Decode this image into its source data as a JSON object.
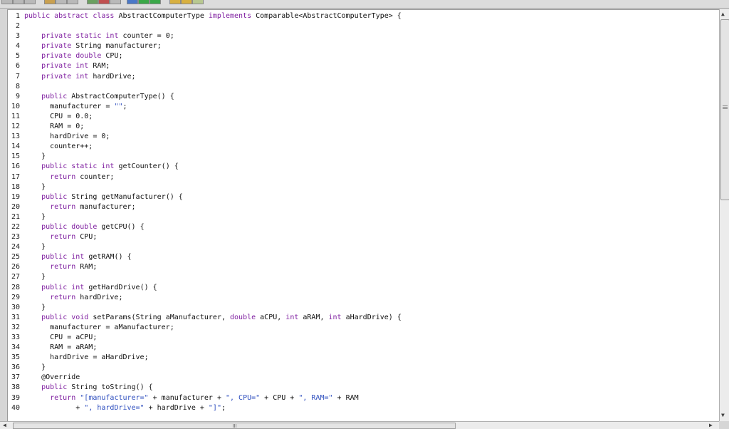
{
  "editor": {
    "lines": [
      {
        "n": "1",
        "tokens": [
          {
            "k": "kw",
            "t": "public abstract class"
          },
          {
            "k": "p",
            "t": " AbstractComputerType "
          },
          {
            "k": "kw",
            "t": "implements"
          },
          {
            "k": "p",
            "t": " Comparable<AbstractComputerType> {"
          }
        ]
      },
      {
        "n": "2",
        "tokens": []
      },
      {
        "n": "3",
        "tokens": [
          {
            "k": "p",
            "t": "    "
          },
          {
            "k": "kw",
            "t": "private static int"
          },
          {
            "k": "p",
            "t": " counter = 0;"
          }
        ]
      },
      {
        "n": "4",
        "tokens": [
          {
            "k": "p",
            "t": "    "
          },
          {
            "k": "kw",
            "t": "private"
          },
          {
            "k": "p",
            "t": " String manufacturer;"
          }
        ]
      },
      {
        "n": "5",
        "tokens": [
          {
            "k": "p",
            "t": "    "
          },
          {
            "k": "kw",
            "t": "private double"
          },
          {
            "k": "p",
            "t": " CPU;"
          }
        ]
      },
      {
        "n": "6",
        "tokens": [
          {
            "k": "p",
            "t": "    "
          },
          {
            "k": "kw",
            "t": "private int"
          },
          {
            "k": "p",
            "t": " RAM;"
          }
        ]
      },
      {
        "n": "7",
        "tokens": [
          {
            "k": "p",
            "t": "    "
          },
          {
            "k": "kw",
            "t": "private int"
          },
          {
            "k": "p",
            "t": " hardDrive;"
          }
        ]
      },
      {
        "n": "8",
        "tokens": []
      },
      {
        "n": "9",
        "tokens": [
          {
            "k": "p",
            "t": "    "
          },
          {
            "k": "kw",
            "t": "public"
          },
          {
            "k": "p",
            "t": " AbstractComputerType() {"
          }
        ]
      },
      {
        "n": "10",
        "tokens": [
          {
            "k": "p",
            "t": "      manufacturer = "
          },
          {
            "k": "str",
            "t": "\"\""
          },
          {
            "k": "p",
            "t": ";"
          }
        ]
      },
      {
        "n": "11",
        "tokens": [
          {
            "k": "p",
            "t": "      CPU = 0.0;"
          }
        ]
      },
      {
        "n": "12",
        "tokens": [
          {
            "k": "p",
            "t": "      RAM = 0;"
          }
        ]
      },
      {
        "n": "13",
        "tokens": [
          {
            "k": "p",
            "t": "      hardDrive = 0;"
          }
        ]
      },
      {
        "n": "14",
        "tokens": [
          {
            "k": "p",
            "t": "      counter++;"
          }
        ]
      },
      {
        "n": "15",
        "tokens": [
          {
            "k": "p",
            "t": "    }"
          }
        ]
      },
      {
        "n": "16",
        "tokens": [
          {
            "k": "p",
            "t": "    "
          },
          {
            "k": "kw",
            "t": "public static int"
          },
          {
            "k": "p",
            "t": " getCounter() {"
          }
        ]
      },
      {
        "n": "17",
        "tokens": [
          {
            "k": "p",
            "t": "      "
          },
          {
            "k": "kw",
            "t": "return"
          },
          {
            "k": "p",
            "t": " counter;"
          }
        ]
      },
      {
        "n": "18",
        "tokens": [
          {
            "k": "p",
            "t": "    }"
          }
        ]
      },
      {
        "n": "19",
        "tokens": [
          {
            "k": "p",
            "t": "    "
          },
          {
            "k": "kw",
            "t": "public"
          },
          {
            "k": "p",
            "t": " String getManufacturer() {"
          }
        ]
      },
      {
        "n": "20",
        "tokens": [
          {
            "k": "p",
            "t": "      "
          },
          {
            "k": "kw",
            "t": "return"
          },
          {
            "k": "p",
            "t": " manufacturer;"
          }
        ]
      },
      {
        "n": "21",
        "tokens": [
          {
            "k": "p",
            "t": "    }"
          }
        ]
      },
      {
        "n": "22",
        "tokens": [
          {
            "k": "p",
            "t": "    "
          },
          {
            "k": "kw",
            "t": "public double"
          },
          {
            "k": "p",
            "t": " getCPU() {"
          }
        ]
      },
      {
        "n": "23",
        "tokens": [
          {
            "k": "p",
            "t": "      "
          },
          {
            "k": "kw",
            "t": "return"
          },
          {
            "k": "p",
            "t": " CPU;"
          }
        ]
      },
      {
        "n": "24",
        "tokens": [
          {
            "k": "p",
            "t": "    }"
          }
        ]
      },
      {
        "n": "25",
        "tokens": [
          {
            "k": "p",
            "t": "    "
          },
          {
            "k": "kw",
            "t": "public int"
          },
          {
            "k": "p",
            "t": " getRAM() {"
          }
        ]
      },
      {
        "n": "26",
        "tokens": [
          {
            "k": "p",
            "t": "      "
          },
          {
            "k": "kw",
            "t": "return"
          },
          {
            "k": "p",
            "t": " RAM;"
          }
        ]
      },
      {
        "n": "27",
        "tokens": [
          {
            "k": "p",
            "t": "    }"
          }
        ]
      },
      {
        "n": "28",
        "tokens": [
          {
            "k": "p",
            "t": "    "
          },
          {
            "k": "kw",
            "t": "public int"
          },
          {
            "k": "p",
            "t": " getHardDrive() {"
          }
        ]
      },
      {
        "n": "29",
        "tokens": [
          {
            "k": "p",
            "t": "      "
          },
          {
            "k": "kw",
            "t": "return"
          },
          {
            "k": "p",
            "t": " hardDrive;"
          }
        ]
      },
      {
        "n": "30",
        "tokens": [
          {
            "k": "p",
            "t": "    }"
          }
        ]
      },
      {
        "n": "31",
        "tokens": [
          {
            "k": "p",
            "t": "    "
          },
          {
            "k": "kw",
            "t": "public void"
          },
          {
            "k": "p",
            "t": " setParams(String aManufacturer, "
          },
          {
            "k": "kw",
            "t": "double"
          },
          {
            "k": "p",
            "t": " aCPU, "
          },
          {
            "k": "kw",
            "t": "int"
          },
          {
            "k": "p",
            "t": " aRAM, "
          },
          {
            "k": "kw",
            "t": "int"
          },
          {
            "k": "p",
            "t": " aHardDrive) {"
          }
        ]
      },
      {
        "n": "32",
        "tokens": [
          {
            "k": "p",
            "t": "      manufacturer = aManufacturer;"
          }
        ]
      },
      {
        "n": "33",
        "tokens": [
          {
            "k": "p",
            "t": "      CPU = aCPU;"
          }
        ]
      },
      {
        "n": "34",
        "tokens": [
          {
            "k": "p",
            "t": "      RAM = aRAM;"
          }
        ]
      },
      {
        "n": "35",
        "tokens": [
          {
            "k": "p",
            "t": "      hardDrive = aHardDrive;"
          }
        ]
      },
      {
        "n": "36",
        "tokens": [
          {
            "k": "p",
            "t": "    }"
          }
        ]
      },
      {
        "n": "37",
        "tokens": [
          {
            "k": "p",
            "t": "    @Override"
          }
        ]
      },
      {
        "n": "38",
        "tokens": [
          {
            "k": "p",
            "t": "    "
          },
          {
            "k": "kw",
            "t": "public"
          },
          {
            "k": "p",
            "t": " String toString() {"
          }
        ]
      },
      {
        "n": "39",
        "tokens": [
          {
            "k": "p",
            "t": "      "
          },
          {
            "k": "kw",
            "t": "return"
          },
          {
            "k": "p",
            "t": " "
          },
          {
            "k": "str",
            "t": "\"[manufacturer=\""
          },
          {
            "k": "p",
            "t": " + manufacturer + "
          },
          {
            "k": "str",
            "t": "\", CPU=\""
          },
          {
            "k": "p",
            "t": " + CPU + "
          },
          {
            "k": "str",
            "t": "\", RAM=\""
          },
          {
            "k": "p",
            "t": " + RAM"
          }
        ]
      },
      {
        "n": "40",
        "tokens": [
          {
            "k": "p",
            "t": "            + "
          },
          {
            "k": "str",
            "t": "\", hardDrive=\""
          },
          {
            "k": "p",
            "t": " + hardDrive + "
          },
          {
            "k": "str",
            "t": "\"]\""
          },
          {
            "k": "p",
            "t": ";"
          }
        ]
      }
    ]
  },
  "colors": {
    "keyword": "#7f1fa0",
    "string": "#2f4fbf",
    "text": "#101010"
  },
  "scrollbars": {
    "up_arrow": "▲",
    "down_arrow": "▼",
    "left_arrow": "◀",
    "right_arrow": "▶",
    "vertical_position": 0.0,
    "horizontal_position": 0.0
  }
}
